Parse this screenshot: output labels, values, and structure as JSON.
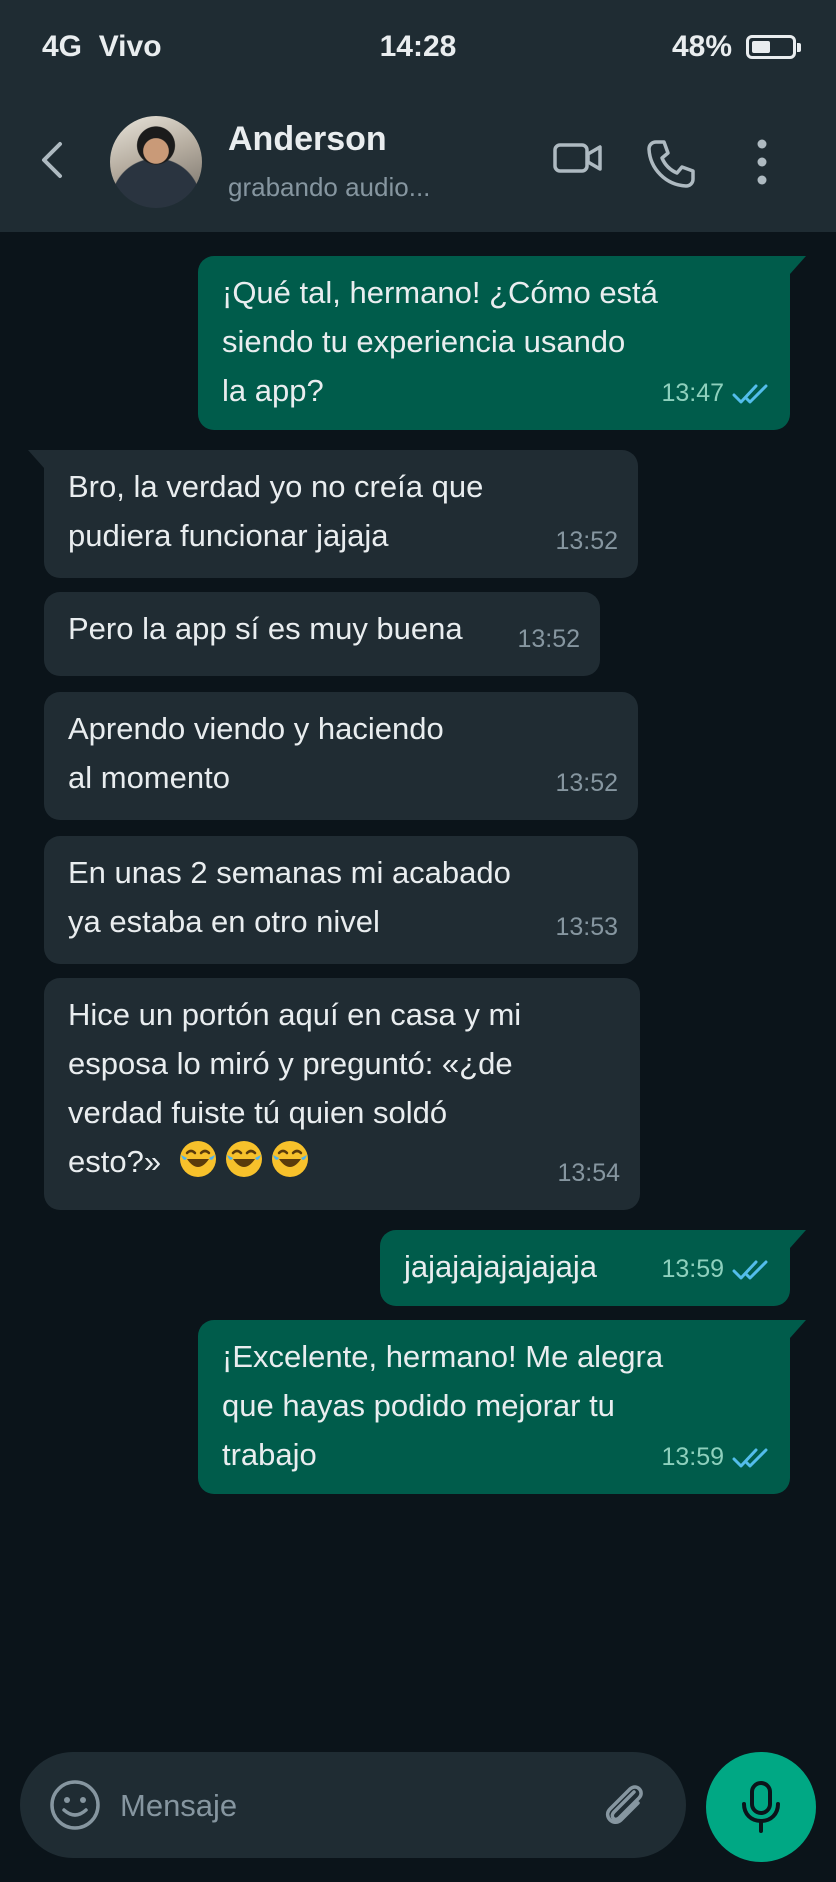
{
  "status_bar": {
    "network": "4G",
    "carrier": "Vivo",
    "time": "14:28",
    "battery": "48%",
    "battery_level": 0.48
  },
  "header": {
    "contact_name": "Anderson",
    "contact_status": "grabando audio..."
  },
  "messages": [
    {
      "direction": "out",
      "text": "¡Qué tal, hermano! ¿Cómo está\nsiendo tu experiencia usando\nla app?",
      "time": "13:47",
      "read": true
    },
    {
      "direction": "in",
      "text": "Bro, la verdad yo no creía que\npudiera funcionar jajaja",
      "time": "13:52"
    },
    {
      "direction": "in",
      "text": "Pero la app sí es muy buena",
      "time": "13:52"
    },
    {
      "direction": "in",
      "text": "Aprendo viendo y haciendo\nal momento",
      "time": "13:52"
    },
    {
      "direction": "in",
      "text": "En unas 2 semanas mi acabado\nya estaba en otro nivel",
      "time": "13:53"
    },
    {
      "direction": "in",
      "text": "Hice un portón aquí en casa y mi\nesposa lo miró y preguntó: «¿de\nverdad fuiste tú quien soldó\nesto?»",
      "emoji": "😂😂😂",
      "time": "13:54"
    },
    {
      "direction": "out",
      "text": "jajajajajajajaja",
      "time": "13:59",
      "read": true
    },
    {
      "direction": "out",
      "text": "¡Excelente, hermano! Me alegra\nque hayas podido mejorar tu\ntrabajo",
      "time": "13:59",
      "read": true
    }
  ],
  "composer": {
    "placeholder": "Mensaje"
  },
  "colors": {
    "background": "#0b141a",
    "bar": "#1f2c33",
    "incoming_bubble": "#202c33",
    "outgoing_bubble": "#005c4b",
    "accent": "#00a884",
    "read_ticks": "#53bdeb"
  },
  "icons": {
    "back": "back-arrow-icon",
    "video": "video-call-icon",
    "phone": "phone-call-icon",
    "menu": "more-vert-icon",
    "emoji": "emoji-icon",
    "attach": "paperclip-icon",
    "mic": "microphone-icon"
  }
}
